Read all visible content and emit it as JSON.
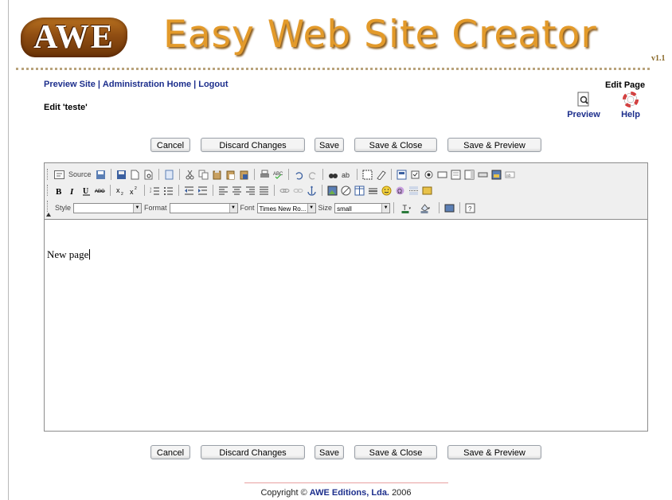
{
  "header": {
    "logo_text": "AWE",
    "title": "Easy Web Site Creator",
    "version": "v1.1"
  },
  "nav": {
    "preview_site": "Preview Site",
    "separator": "|",
    "admin_home": "Administration Home",
    "logout": "Logout"
  },
  "page": {
    "edit_title": "Edit 'teste'",
    "edit_page_label": "Edit Page",
    "preview_label": "Preview",
    "help_label": "Help"
  },
  "buttons": {
    "cancel": "Cancel",
    "discard": "Discard Changes",
    "save": "Save",
    "save_close": "Save & Close",
    "save_preview": "Save & Preview"
  },
  "toolbar": {
    "source_label": "Source",
    "style_label": "Style",
    "format_label": "Format",
    "font_label": "Font",
    "font_value": "Times New Ro...",
    "size_label": "Size",
    "size_value": "small",
    "icons_row1": [
      "new-page-icon",
      "save-icon",
      "new-doc-icon",
      "preview-icon",
      "templates-icon",
      "cut-icon",
      "copy-icon",
      "paste-icon",
      "paste-text-icon",
      "paste-word-icon",
      "print-icon",
      "spellcheck-icon",
      "undo-icon",
      "redo-icon",
      "find-icon",
      "replace-icon",
      "select-all-icon",
      "remove-format-icon",
      "form-icon",
      "checkbox-icon",
      "radio-icon",
      "textfield-icon",
      "textarea-icon",
      "select-icon",
      "button-icon",
      "image-button-icon",
      "hidden-field-icon"
    ],
    "icons_row2": [
      "bold-icon",
      "italic-icon",
      "underline-icon",
      "strike-icon",
      "subscript-icon",
      "superscript-icon",
      "ordered-list-icon",
      "unordered-list-icon",
      "outdent-icon",
      "indent-icon",
      "align-left-icon",
      "align-center-icon",
      "align-right-icon",
      "justify-icon",
      "link-icon",
      "unlink-icon",
      "anchor-icon",
      "image-icon",
      "flash-icon",
      "table-icon",
      "rule-icon",
      "smiley-icon",
      "special-char-icon",
      "page-break-icon",
      "universal-key-icon"
    ]
  },
  "editor": {
    "content": "New page"
  },
  "footer": {
    "prefix": "Copyright ©",
    "company": "AWE Editions, Lda.",
    "year": "2006"
  },
  "colors": {
    "link": "#1c2e8c",
    "title": "#e39a2a",
    "logo_wood": "#8f4d12"
  }
}
